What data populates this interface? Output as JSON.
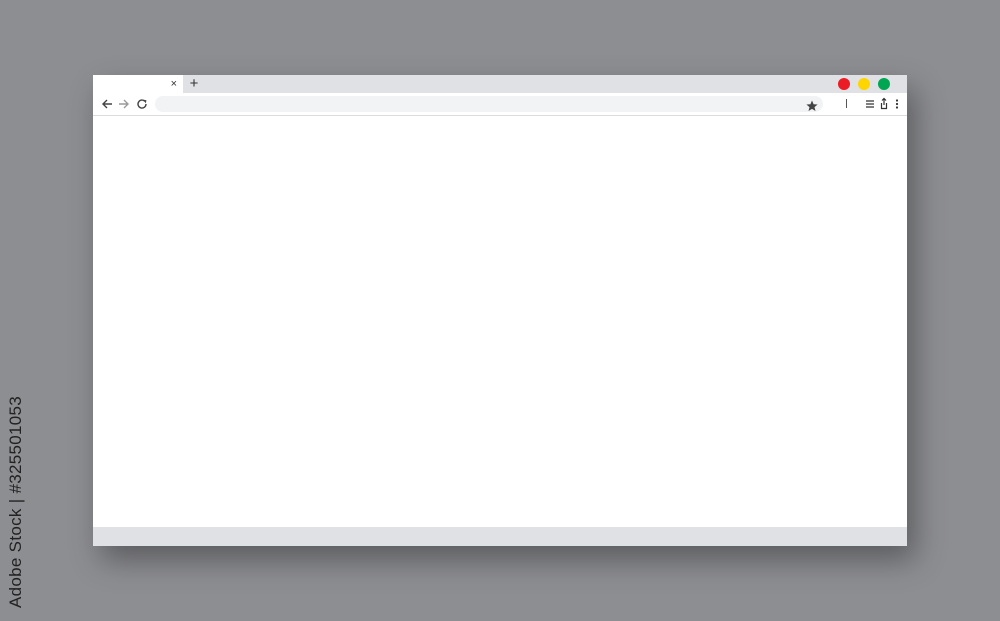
{
  "watermark": "Adobe Stock | #325501053",
  "colors": {
    "background": "#8d8e92",
    "chrome": "#dfe1e5",
    "close_dot": "#ec1c24",
    "minimize_dot": "#ffd500",
    "maximize_dot": "#00a651"
  },
  "browser": {
    "tab": {
      "close_label": "×"
    },
    "new_tab_label": "+",
    "address_bar": {
      "value": "",
      "placeholder": ""
    },
    "icons": {
      "back": "arrow-left-icon",
      "forward": "arrow-right-icon",
      "reload": "reload-icon",
      "bookmark": "star-icon",
      "menu": "hamburger-menu-icon",
      "share": "share-icon",
      "more": "kebab-menu-icon"
    }
  }
}
